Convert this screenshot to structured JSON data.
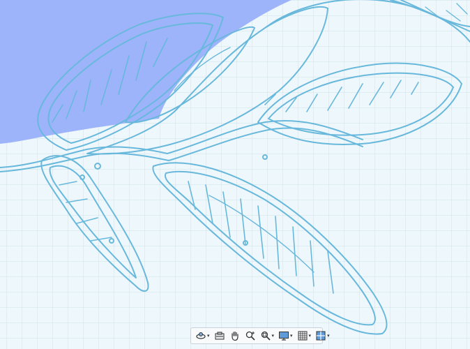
{
  "canvas": {
    "background": "#eef7fb",
    "grid_color": "#cfe3ea",
    "region_fill": "#9db4fb",
    "stroke_color": "#68b8dc"
  },
  "toolbar": {
    "tools": [
      {
        "icon": "orbit-icon",
        "has_dropdown": true
      },
      {
        "icon": "look-at-icon",
        "has_dropdown": false
      },
      {
        "icon": "pan-hand-icon",
        "has_dropdown": false
      },
      {
        "icon": "zoom-icon",
        "has_dropdown": false
      },
      {
        "icon": "zoom-window-icon",
        "has_dropdown": true
      },
      {
        "icon": "display-settings-icon",
        "has_dropdown": true
      },
      {
        "icon": "grid-settings-icon",
        "has_dropdown": true
      },
      {
        "icon": "viewports-icon",
        "has_dropdown": true
      }
    ]
  }
}
